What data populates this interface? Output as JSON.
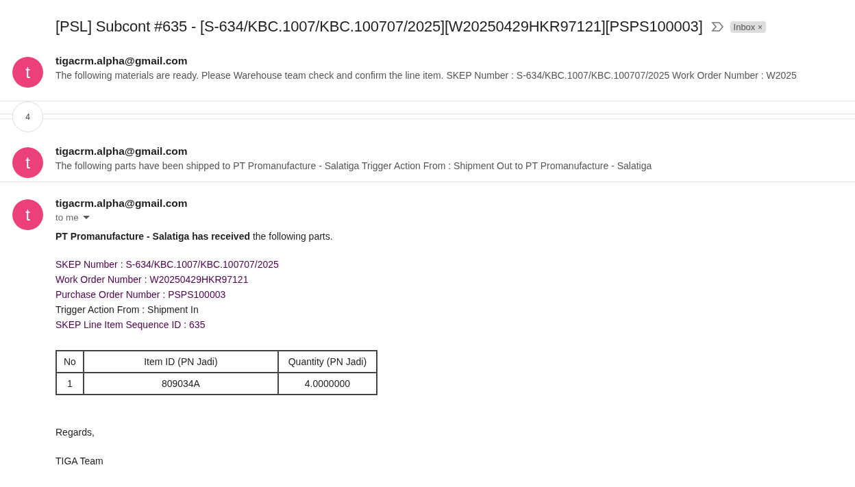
{
  "subject": "[PSL] Subcont #635 - [S-634/KBC.1007/KBC.100707/2025][W20250429HKR97121][PSPS100003]",
  "label": {
    "text": "Inbox",
    "remove": "×"
  },
  "messages": [
    {
      "avatar": "t",
      "sender": "tigacrm.alpha@gmail.com",
      "snippet": "The following materials are ready. Please Warehouse team check and confirm the line item. SKEP Number : S-634/KBC.1007/KBC.100707/2025 Work Order Number : W2025",
      "expanded": false
    },
    {
      "collapsed_count": "4"
    },
    {
      "avatar": "t",
      "sender": "tigacrm.alpha@gmail.com",
      "snippet": "The following parts have been shipped to PT Promanufacture - Salatiga Trigger Action From : Shipment Out to PT Promanufacture - Salatiga",
      "expanded": false
    },
    {
      "avatar": "t",
      "sender": "tigacrm.alpha@gmail.com",
      "recipient": "to me",
      "expanded": true
    }
  ],
  "body": {
    "intro": "**PT Promanufacture - Salatiga has received** the following parts.",
    "lines": [
      {
        "text": "SKEP Number : S-634/KBC.1007/KBC.100707/2025",
        "kind": "link"
      },
      {
        "text": "Work Order Number : W20250429HKR97121",
        "kind": "link"
      },
      {
        "text": "Purchase Order Number : PSPS100003",
        "kind": "link"
      },
      {
        "text": "Trigger Action From : Shipment In",
        "kind": "plain"
      },
      {
        "text": "SKEP Line Item Sequence ID : 635",
        "kind": "link"
      }
    ],
    "table": {
      "columns": [
        "No",
        "Item ID (PN Jadi)",
        "Quantity (PN Jadi)"
      ],
      "rows": [
        [
          "1",
          "809034A",
          "4.0000000"
        ]
      ]
    },
    "closing": "Regards,",
    "signature": "TIGA Team"
  }
}
